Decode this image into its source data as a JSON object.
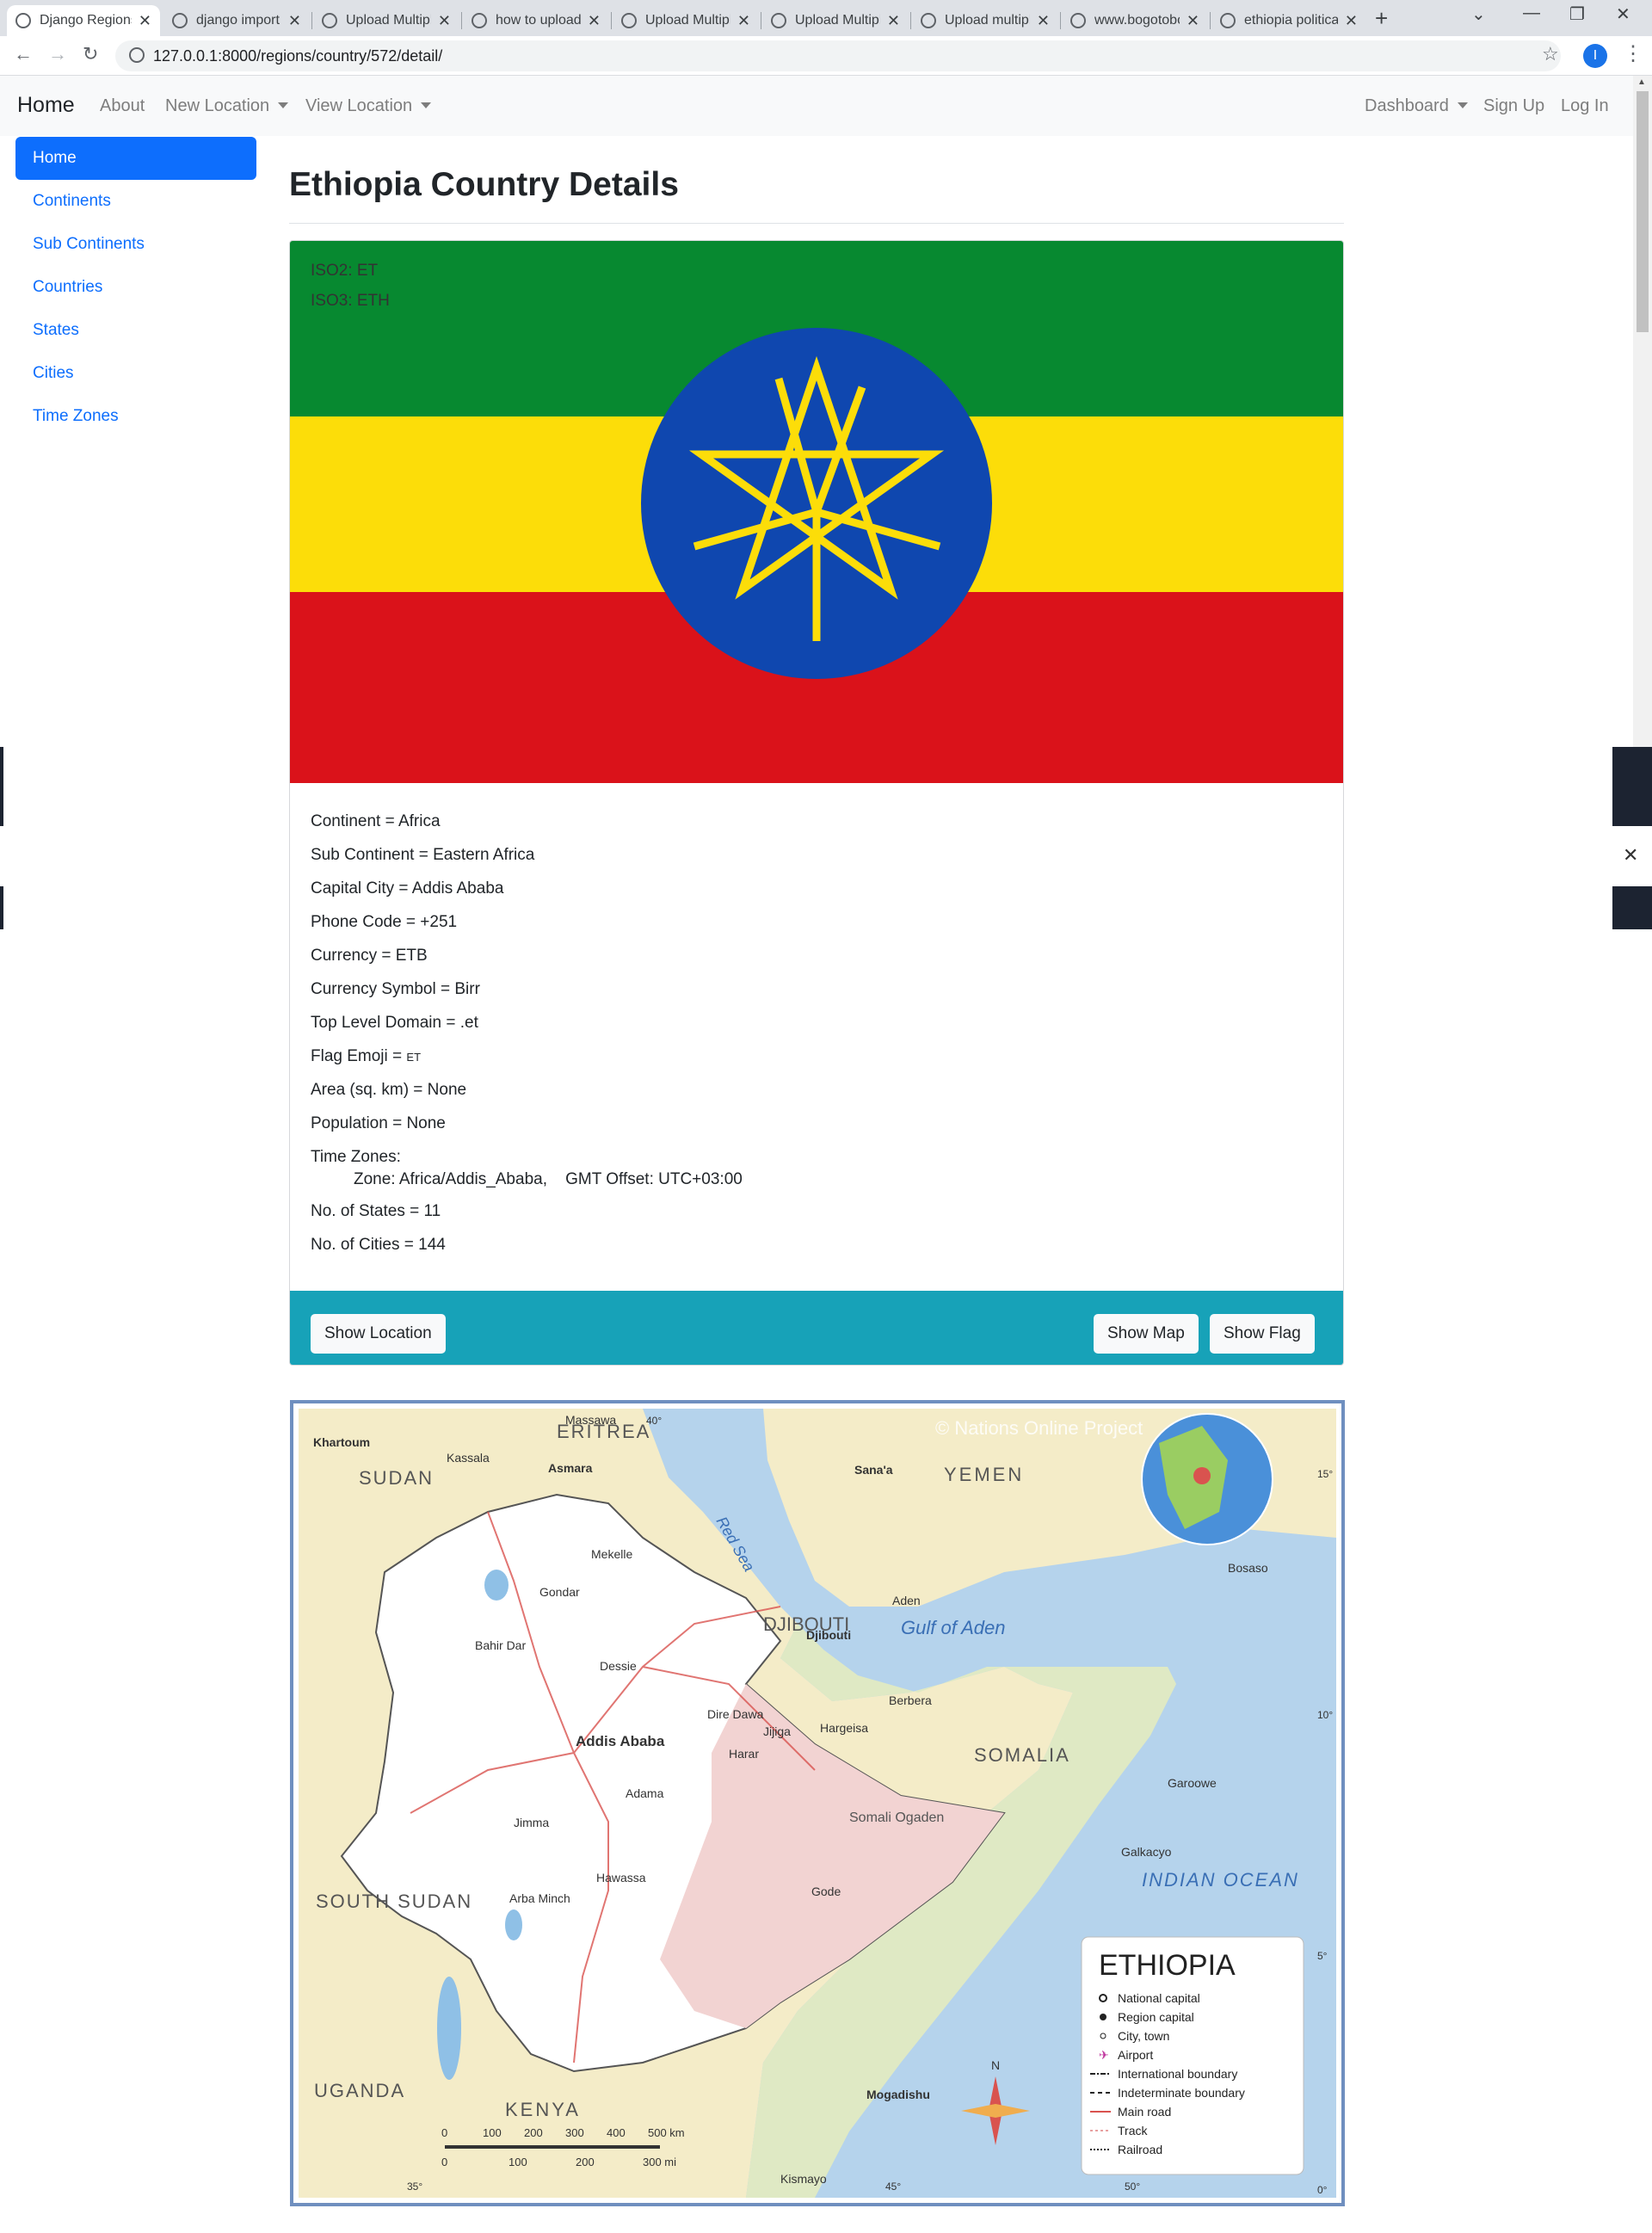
{
  "browser": {
    "tabs": [
      {
        "title": "Django Regions",
        "active": true
      },
      {
        "title": "django import"
      },
      {
        "title": "Upload Multiple"
      },
      {
        "title": "how to upload"
      },
      {
        "title": "Upload Multiple"
      },
      {
        "title": "Upload Multiple"
      },
      {
        "title": "Upload multiple"
      },
      {
        "title": "www.bogotobogo"
      },
      {
        "title": "ethiopia political"
      }
    ],
    "url": "127.0.0.1:8000/regions/country/572/detail/",
    "profile_initial": "I"
  },
  "navbar": {
    "brand": "Home",
    "about": "About",
    "new_location": "New Location",
    "view_location": "View Location",
    "dashboard": "Dashboard",
    "sign_up": "Sign Up",
    "log_in": "Log In"
  },
  "sidebar": {
    "items": [
      {
        "label": "Home",
        "active": true
      },
      {
        "label": "Continents"
      },
      {
        "label": "Sub Continents"
      },
      {
        "label": "Countries"
      },
      {
        "label": "States"
      },
      {
        "label": "Cities"
      },
      {
        "label": "Time Zones"
      }
    ]
  },
  "country": {
    "title": "Ethiopia Country Details",
    "iso2": "ISO2: ET",
    "iso3": "ISO3: ETH",
    "flag_colors": {
      "green": "#078930",
      "yellow": "#FCDD09",
      "red": "#DA121A",
      "blue": "#0F47AF"
    },
    "details": [
      "Continent = Africa",
      "Sub Continent = Eastern Africa",
      "Capital City = Addis Ababa",
      "Phone Code = +251",
      "Currency = ETB",
      "Currency Symbol = Birr",
      "Top Level Domain = .et"
    ],
    "flag_emoji_label": "Flag Emoji = ",
    "flag_emoji_value": "ET",
    "area": "Area (sq. km) = None",
    "population": "Population = None",
    "time_zones_label": "Time Zones:",
    "time_zone_line": "Zone: Africa/Addis_Ababa,    GMT Offset: UTC+03:00",
    "states": "No. of States = 11",
    "cities": "No. of Cities = 144"
  },
  "buttons": {
    "show_location": "Show Location",
    "show_map": "Show Map",
    "show_flag": "Show Flag"
  },
  "map": {
    "watermark": "© Nations Online Project",
    "legend_title": "ETHIOPIA",
    "legend": [
      "National capital",
      "Region capital",
      "City, town",
      "Airport",
      "International boundary",
      "Indeterminate boundary",
      "Main road",
      "Track",
      "Railroad"
    ],
    "countries": [
      "ERITREA",
      "SUDAN",
      "YEMEN",
      "DJIBOUTI",
      "SOMALIA",
      "SOUTH SUDAN",
      "KENYA",
      "UGANDA"
    ],
    "seas": [
      "Red Sea",
      "Gulf of Aden",
      "INDIAN OCEAN"
    ],
    "region_label": "Somali Ogaden",
    "cities": [
      "Khartoum",
      "Kassala",
      "Asmara",
      "Massawa",
      "Sana'a",
      "Aden",
      "Djibouti",
      "Mekelle",
      "Gondar",
      "Bahir Dar",
      "Dessie",
      "Dire Dawa",
      "Harar",
      "Jijiga",
      "Hargeisa",
      "Berbera",
      "Addis Ababa",
      "Adama",
      "Jimma",
      "Hawassa",
      "Arba Minch",
      "Gode",
      "Mogadishu",
      "Kismayo",
      "Garoowe",
      "Bosaso",
      "Galkacyo"
    ],
    "scale_km": [
      "0",
      "100",
      "200",
      "300",
      "400",
      "500 km"
    ],
    "scale_mi": [
      "0",
      "100",
      "200",
      "300 mi"
    ],
    "lat_labels": [
      "15°",
      "10°",
      "5°",
      "0°"
    ],
    "lon_labels": [
      "35°",
      "40°",
      "45°",
      "50°"
    ],
    "compass_n": "N"
  }
}
